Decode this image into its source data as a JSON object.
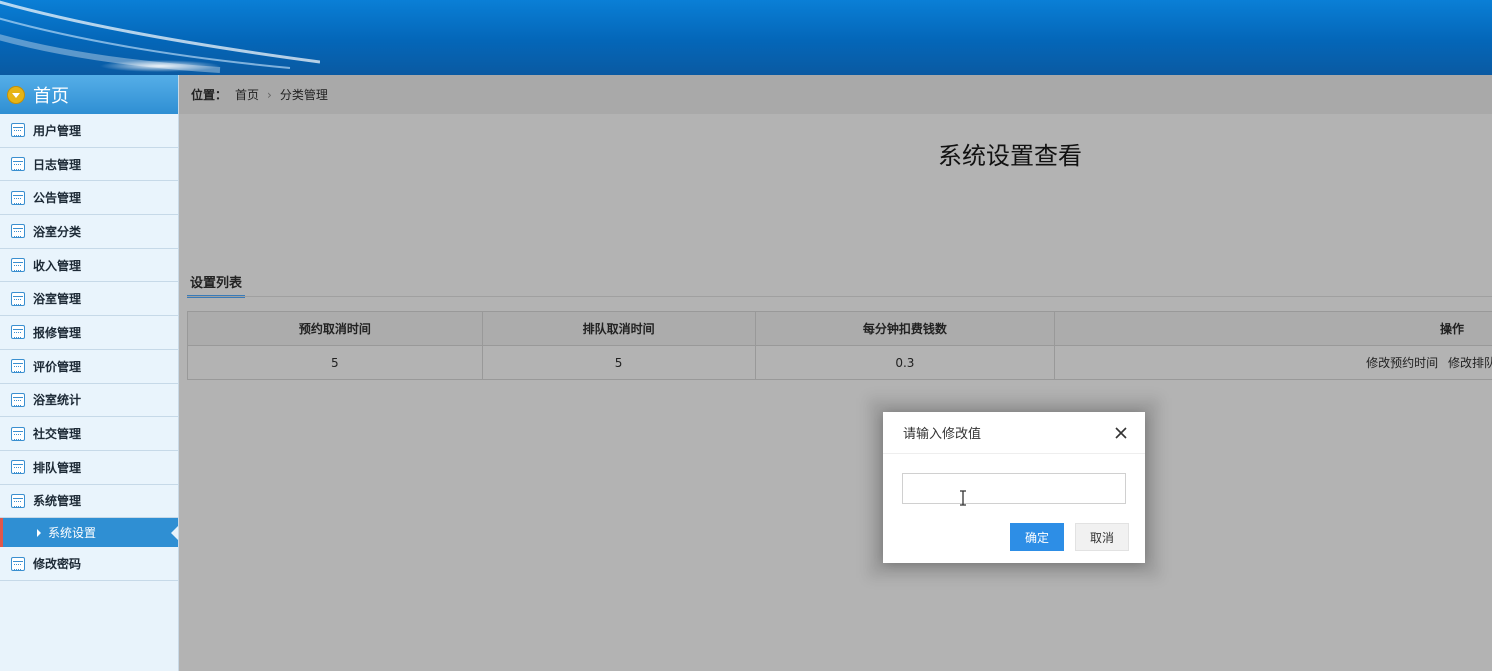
{
  "sidebar": {
    "home_label": "首页",
    "items": [
      {
        "label": "用户管理"
      },
      {
        "label": "日志管理"
      },
      {
        "label": "公告管理"
      },
      {
        "label": "浴室分类"
      },
      {
        "label": "收入管理"
      },
      {
        "label": "浴室管理"
      },
      {
        "label": "报修管理"
      },
      {
        "label": "评价管理"
      },
      {
        "label": "浴室统计"
      },
      {
        "label": "社交管理"
      },
      {
        "label": "排队管理"
      },
      {
        "label": "系统管理"
      }
    ],
    "active_sub": "系统设置",
    "last_item": "修改密码"
  },
  "breadcrumb": {
    "label": "位置：",
    "home": "首页",
    "current": "分类管理"
  },
  "page": {
    "title": "系统设置查看",
    "section_tab": "设置列表"
  },
  "table": {
    "headers": [
      "预约取消时间",
      "排队取消时间",
      "每分钟扣费钱数",
      "操作"
    ],
    "row": {
      "reserve_cancel": "5",
      "queue_cancel": "5",
      "fee_per_minute": "0.3",
      "op_edit_reserve": "修改预约时间",
      "op_edit_queue": "修改排队时"
    }
  },
  "dialog": {
    "title": "请输入修改值",
    "input_value": "",
    "ok_label": "确定",
    "cancel_label": "取消"
  },
  "icons": {
    "home": "chevron-down-circle-icon",
    "menu": "calendar-icon",
    "close": "close-icon",
    "cursor": "text-cursor-icon"
  },
  "colors": {
    "header_blue": "#0466b8",
    "sidebar_active": "#2f8fd3",
    "ok_button": "#2d8ee6"
  }
}
